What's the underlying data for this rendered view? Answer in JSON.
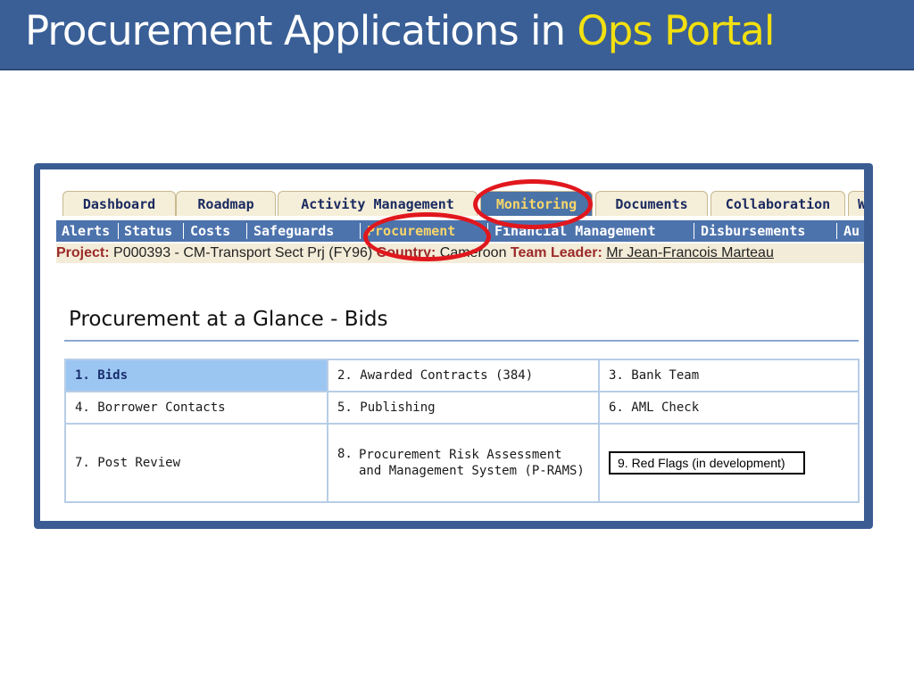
{
  "slide": {
    "title_prefix": "Procurement Applications in ",
    "title_highlight": "Ops Portal"
  },
  "portal": {
    "tabs": [
      {
        "label": "Dashboard"
      },
      {
        "label": "Roadmap"
      },
      {
        "label": "Activity Management"
      },
      {
        "label": "Monitoring",
        "active": true
      },
      {
        "label": "Documents"
      },
      {
        "label": "Collaboration"
      },
      {
        "label": "W"
      }
    ],
    "subnav": [
      {
        "label": "Alerts"
      },
      {
        "label": "Status"
      },
      {
        "label": "Costs"
      },
      {
        "label": "Safeguards"
      },
      {
        "label": "Procurement",
        "active": true
      },
      {
        "label": "Financial Management"
      },
      {
        "label": "Disbursements"
      },
      {
        "label": "Au"
      }
    ],
    "project": {
      "project_label": "Project:",
      "project_value": "P000393 - CM-Transport Sect Prj (FY96)",
      "country_label": "Country:",
      "country_value": "Cameroon",
      "leader_label": "Team Leader:",
      "leader_value": "Mr Jean-Francois Marteau"
    },
    "heading": "Procurement at a Glance - Bids",
    "grid": {
      "c1": "1. Bids",
      "c2": "2. Awarded Contracts (384)",
      "c3": "3. Bank Team",
      "c4": "4. Borrower Contacts",
      "c5": "5. Publishing",
      "c6": "6. AML Check",
      "c7": "7. Post Review",
      "c8_num": "8.",
      "c8": "Procurement Risk Assessment and Management System (P-RAMS)",
      "c9": "9. Red Flags  (in development)"
    }
  },
  "colors": {
    "title_bar": "#3a5f96",
    "title_highlight": "#f2e010",
    "callout": "#e1171e",
    "active_tab": "#4a73a8"
  }
}
